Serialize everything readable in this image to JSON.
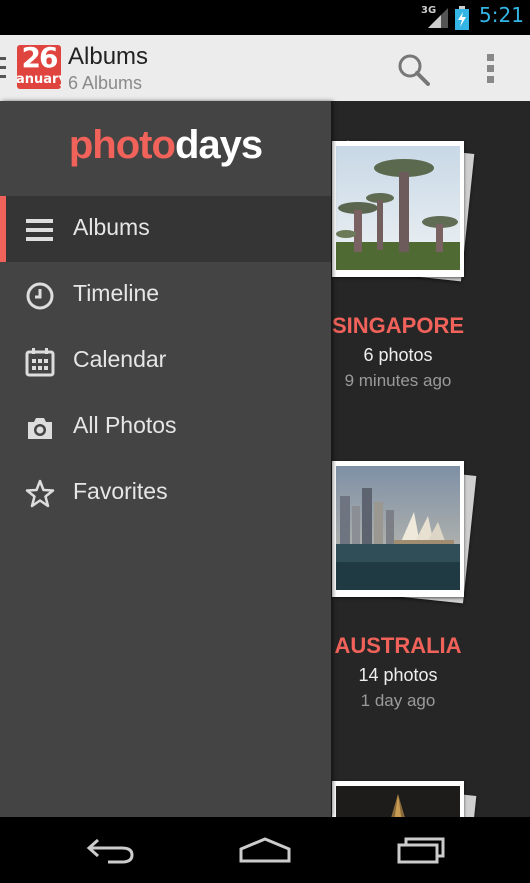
{
  "status_bar": {
    "network": "3G",
    "time": "5:21",
    "icons": [
      "signal-icon",
      "battery-charging-icon"
    ]
  },
  "action_bar": {
    "app_icon_day": "26",
    "app_icon_month": "anuary",
    "title": "Albums",
    "subtitle": "6 Albums",
    "actions": [
      "search-icon",
      "overflow-menu-icon"
    ]
  },
  "drawer": {
    "logo_part1": "photo",
    "logo_part2": "days",
    "items": [
      {
        "label": "Albums",
        "icon": "list-icon",
        "active": true
      },
      {
        "label": "Timeline",
        "icon": "clock-icon",
        "active": false
      },
      {
        "label": "Calendar",
        "icon": "calendar-icon",
        "active": false
      },
      {
        "label": "All Photos",
        "icon": "camera-icon",
        "active": false
      },
      {
        "label": "Favorites",
        "icon": "star-icon",
        "active": false
      }
    ]
  },
  "albums": [
    {
      "name": "SINGAPORE",
      "count": "6 photos",
      "time": "9 minutes ago"
    },
    {
      "name": "AUSTRALIA",
      "count": "14 photos",
      "time": "1 day ago"
    }
  ],
  "colors": {
    "accent": "#f0625a",
    "drawer_bg": "#444444",
    "content_bg": "#262626",
    "status_time": "#33b5e5"
  },
  "nav_bar": [
    "back-icon",
    "home-icon",
    "recents-icon"
  ]
}
